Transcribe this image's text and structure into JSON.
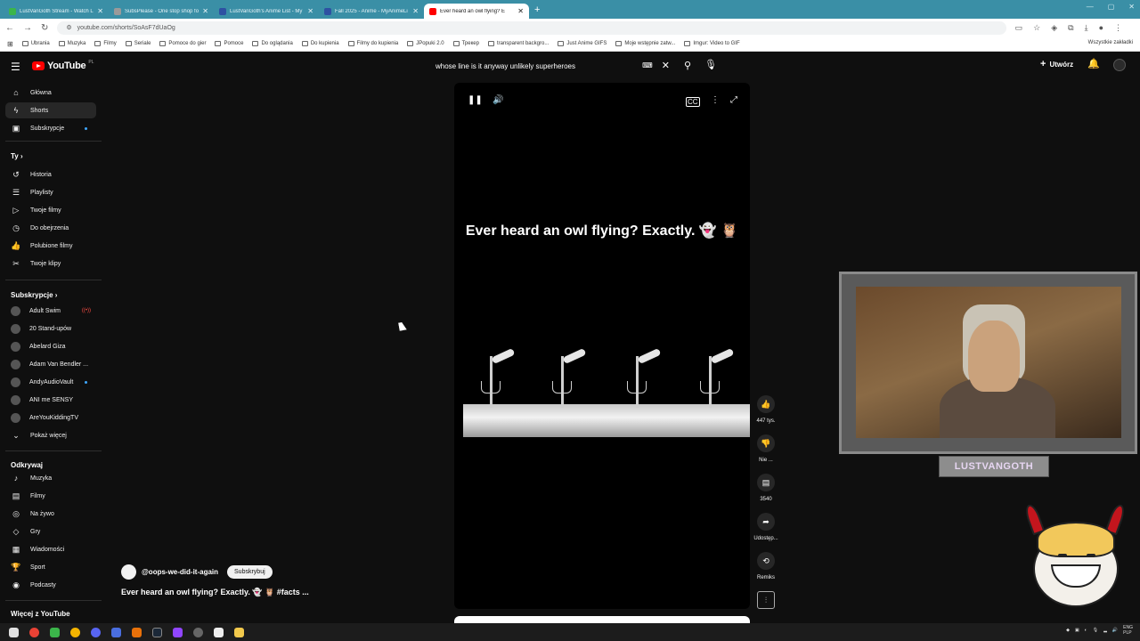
{
  "browser": {
    "tabs": [
      {
        "title": "LustVanGoth Stream - Watch L",
        "color": "#3bb54a",
        "active": false
      },
      {
        "title": "SubsPlease - One stop shop fo",
        "color": "#9a9a9a",
        "active": false
      },
      {
        "title": "LustVanGoth's Anime List - My",
        "color": "#2e51a2",
        "active": false
      },
      {
        "title": "Fall 2025 - Anime - MyAnimeLi",
        "color": "#2e51a2",
        "active": false
      },
      {
        "title": "Ever heard an owl flying? E",
        "color": "#ff0000",
        "active": true
      }
    ],
    "url": "youtube.com/shorts/SoAsF7dUaOg",
    "bookmarks": [
      "Ubrania",
      "Muzyka",
      "Filmy",
      "Seriale",
      "Pomoce do gier",
      "Pomoce",
      "Do oglądania",
      "Do kupienia",
      "Filmy do kupienia",
      "JPopuki 2.0",
      "Трекер",
      "transparent backgro...",
      "Just Anime GIFS",
      "Moje wstępnie zatw...",
      "Imgur: Video to GIF"
    ],
    "bookmarks_right": "Wszystkie zakładki"
  },
  "header": {
    "logo": "YouTube",
    "logo_country": "PL",
    "search_value": "whose line is it anyway unlikely superheroes",
    "create_label": "Utwórz"
  },
  "sidebar": {
    "main": [
      {
        "label": "Główna",
        "icon": "home-icon",
        "glyph": "⌂"
      },
      {
        "label": "Shorts",
        "icon": "shorts-icon",
        "glyph": "ϟ",
        "active": true
      },
      {
        "label": "Subskrypcje",
        "icon": "subscriptions-icon",
        "glyph": "▣",
        "dot": true
      }
    ],
    "you_heading": "Ty",
    "you": [
      {
        "label": "Historia",
        "icon": "history-icon",
        "glyph": "↺"
      },
      {
        "label": "Playlisty",
        "icon": "playlists-icon",
        "glyph": "☰"
      },
      {
        "label": "Twoje filmy",
        "icon": "your-videos-icon",
        "glyph": "▷"
      },
      {
        "label": "Do obejrzenia",
        "icon": "watch-later-icon",
        "glyph": "◷"
      },
      {
        "label": "Polubione filmy",
        "icon": "liked-icon",
        "glyph": "👍"
      },
      {
        "label": "Twoje klipy",
        "icon": "clips-icon",
        "glyph": "✂"
      }
    ],
    "subs_heading": "Subskrypcje",
    "subs": [
      {
        "label": "Adult Swim",
        "badge": "((•))"
      },
      {
        "label": "20 Stand-upów"
      },
      {
        "label": "Abelard Giza"
      },
      {
        "label": "Adam Van Bendler ..."
      },
      {
        "label": "AndyAudioVault",
        "dot": true
      },
      {
        "label": "ANI me SENSY"
      },
      {
        "label": "AreYouKiddingTV"
      }
    ],
    "show_more": "Pokaż więcej",
    "explore_heading": "Odkrywaj",
    "explore": [
      {
        "label": "Muzyka",
        "icon": "music-icon",
        "glyph": "♪"
      },
      {
        "label": "Filmy",
        "icon": "movies-icon",
        "glyph": "▤"
      },
      {
        "label": "Na żywo",
        "icon": "live-icon",
        "glyph": "◎"
      },
      {
        "label": "Gry",
        "icon": "gaming-icon",
        "glyph": "◇"
      },
      {
        "label": "Wiadomości",
        "icon": "news-icon",
        "glyph": "▦"
      },
      {
        "label": "Sport",
        "icon": "sport-icon",
        "glyph": "🏆"
      },
      {
        "label": "Podcasty",
        "icon": "podcasts-icon",
        "glyph": "◉"
      }
    ],
    "more_heading": "Więcej z YouTube"
  },
  "short": {
    "caption": "Ever heard an owl flying? Exactly. 👻 🦉",
    "channel": "@oops-we-did-it-again",
    "subscribe": "Subskrybuj",
    "title": "Ever heard an owl flying? Exactly. 👻 🦉 #facts ..."
  },
  "actions": {
    "likes": "447 tys.",
    "dislike": "Nie ...",
    "comments": "3540",
    "share": "Udostęp...",
    "remix": "Remiks"
  },
  "overlay": {
    "nameplate": "LUSTVANGOTH"
  },
  "taskbar": {
    "lang_top": "ENG",
    "lang_bottom": "PLP"
  }
}
